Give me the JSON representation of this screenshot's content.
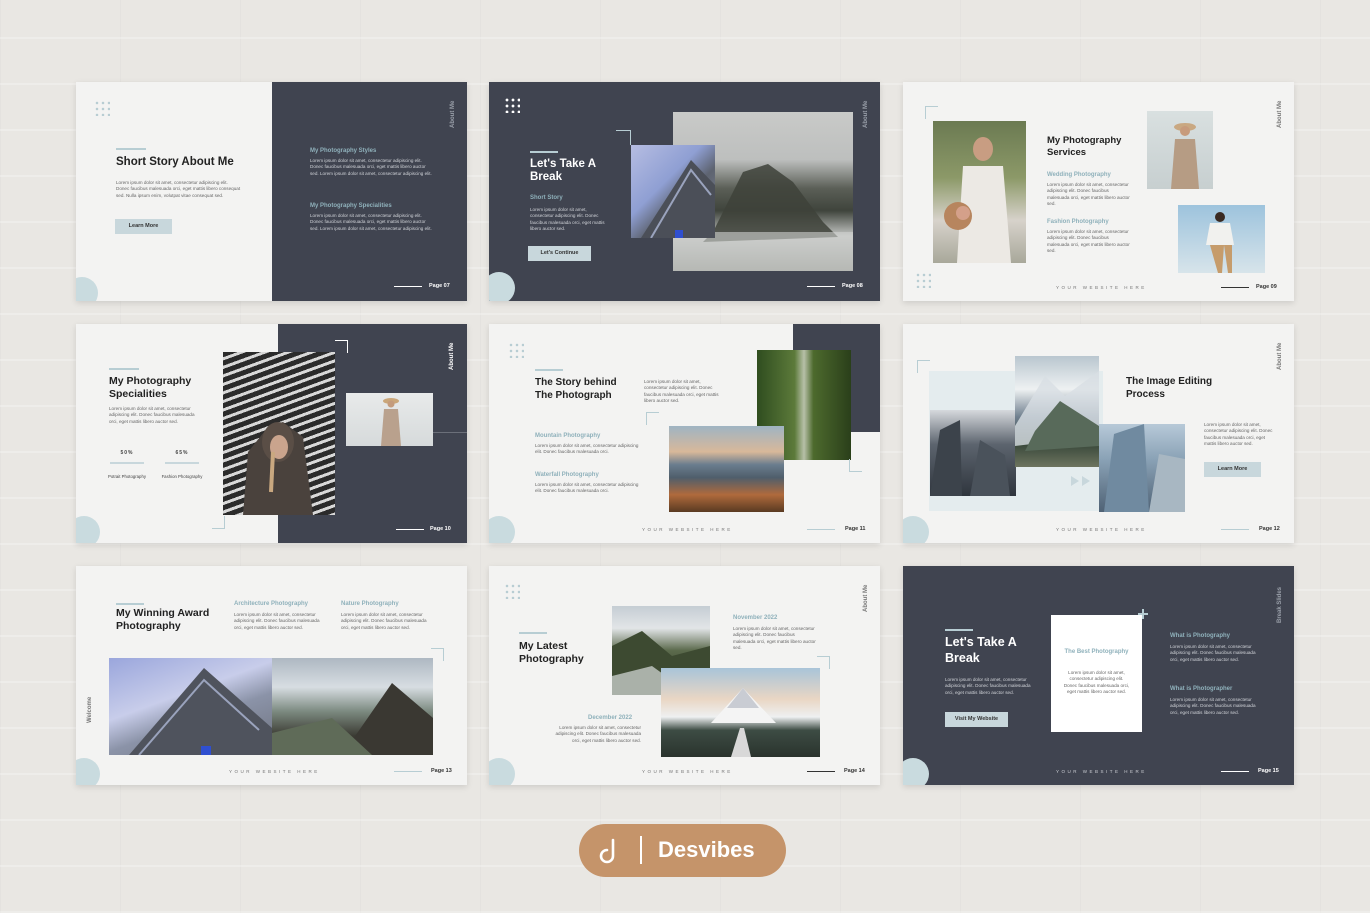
{
  "s1": {
    "title": "Short Story About Me",
    "body": "Lorem ipsum dolor sit amet, consectetur adipiscing elit. Donec faucibus malesuada orci, eget mattis libero consequat sed. Nulla ipsum enim, volutpat vitae consequat sed.",
    "button": "Learn More",
    "vertical": "About Me",
    "h1": "My Photography Styles",
    "b1": "Lorem ipsum dolor sit amet, consectetur adipiscing elit. Donec faucibus malesuada orci, eget mattis libero auctor sed. Lorem ipsum dolor sit amet, consectetur adipiscing elit.",
    "h2": "My Photography Specialities",
    "b2": "Lorem ipsum dolor sit amet, consectetur adipiscing elit. Donec faucibus malesuada orci, eget mattis libero auctor sed. Lorem ipsum dolor sit amet, consectetur adipiscing elit.",
    "page": "Page 07"
  },
  "s2": {
    "title": "Let's Take A Break",
    "sub": "Short Story",
    "body": "Lorem ipsum dolor sit amet, consectetur adipiscing elit. Donec faucibus malesuada orci, eget mattis libero auctor sed.",
    "button": "Let's Continue",
    "vertical": "About Me",
    "page": "Page 08"
  },
  "s3": {
    "title": "My Photography Services",
    "h1": "Wedding  Photography",
    "b1": "Lorem ipsum dolor sit amet, consectetur adipiscing elit. Donec faucibus malesuada orci, eget mattis libero auctor sed.",
    "h2": "Fashion  Photography",
    "b2": "Lorem ipsum dolor sit amet, consectetur adipiscing elit. Donec faucibus malesuada orci, eget mattis libero auctor sed.",
    "vertical": "About Me",
    "website": "YOUR WEBSITE HERE",
    "page": "Page 09"
  },
  "s4": {
    "title": "My Photography Specialities",
    "body": "Lorem ipsum dolor sit amet, consectetur adipiscing elit. Donec faucibus malesuada orci, eget mattis libero auctor sed.",
    "pct1": "50%",
    "label1": "Potrait Photography",
    "pct2": "65%",
    "label2": "Fashion Photography",
    "vertical": "About Me",
    "page": "Page 10"
  },
  "s5": {
    "title": "The Story behind The Photograph",
    "intro": "Lorem ipsum dolor sit amet, consectetur adipiscing elit. Donec faucibus malesuada orci, eget mattis libero auctor sed.",
    "h1": "Mountain Photography",
    "b1": "Lorem ipsum dolor sit amet, consectetur adipiscing elit. Donec faucibus malesuada orci.",
    "h2": "Waterfall Photography",
    "b2": "Lorem ipsum dolor sit amet, consectetur adipiscing elit. Donec faucibus malesuada orci.",
    "website": "YOUR WEBSITE HERE",
    "page": "Page 11"
  },
  "s6": {
    "title": "The Image Editing Process",
    "body": "Lorem ipsum dolor sit amet, consectetur adipiscing elit. Donec faucibus malesuada orci, eget mattis libero auctor sed.",
    "button": "Learn More",
    "vertical": "About Me",
    "website": "YOUR WEBSITE HERE",
    "page": "Page 12"
  },
  "s7": {
    "title": "My Winning Award Photography",
    "h1": "Architecture Photography",
    "b1": "Lorem ipsum dolor sit amet, consectetur adipiscing elit. Donec faucibus malesuada orci, eget mattis libero auctor sed.",
    "h2": "Nature Photography",
    "b2": "Lorem ipsum dolor sit amet, consectetur adipiscing elit. Donec faucibus malesuada orci, eget mattis libero auctor sed.",
    "vertical": "Welcome",
    "website": "YOUR WEBSITE HERE",
    "page": "Page 13"
  },
  "s8": {
    "title": "My Latest Photography",
    "d1": "November 2022",
    "b1": "Lorem ipsum dolor sit amet, consectetur adipiscing elit. Donec faucibus malesuada orci, eget mattis libero auctor sed.",
    "d2": "December 2022",
    "b2": "Lorem ipsum dolor sit amet, consectetur adipiscing elit. Donec faucibus malesuada orci, eget mattis libero auctor sed.",
    "vertical": "About Me",
    "website": "YOUR WEBSITE HERE",
    "page": "Page 14"
  },
  "s9": {
    "title": "Let's Take A Break",
    "body": "Lorem ipsum dolor sit amet, consectetur adipiscing elit. Donec faucibus malesuada orci, eget mattis libero auctor sed.",
    "button": "Visit My Website",
    "card_title": "The Best Photography",
    "card_body": "Lorem ipsum dolor sit amet, consectetur adipiscing elit. Donec faucibus malesuada orci, eget mattis libero auctor sed.",
    "h1": "What is Photography",
    "b1": "Lorem ipsum dolor sit amet, consectetur adipiscing elit. Donec faucibus malesuada orci, eget mattis libero auctor sed.",
    "h2": "What is Photographer",
    "b2": "Lorem ipsum dolor sit amet, consectetur adipiscing elit. Donec faucibus malesuada orci, eget mattis libero auctor sed.",
    "vertical": "Break Slides",
    "website": "YOUR WEBSITE HERE",
    "page": "Page 15"
  },
  "brand": {
    "name": "Desvibes",
    "logo": "desvibes-d-logo"
  },
  "colors": {
    "dark": "#404450",
    "light": "#f3f3f2",
    "accent": "#8fb1bb",
    "brand": "#c5946a"
  }
}
